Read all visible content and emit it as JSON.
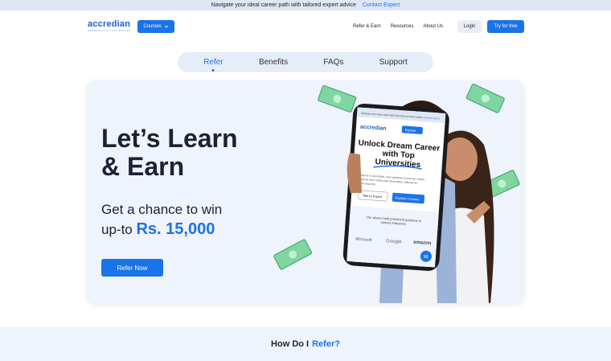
{
  "topbar": {
    "message": "Navigate your ideal career path with tailored expert advice",
    "link": "Contact Expert"
  },
  "nav": {
    "logo": "accredian",
    "logo_tag": "CREDENTIALS THAT MATTER",
    "courses": "Courses",
    "links": [
      "Refer & Earn",
      "Resources",
      "About Us"
    ],
    "login": "Login",
    "try": "Try for free"
  },
  "tabs": [
    "Refer",
    "Benefits",
    "FAQs",
    "Support"
  ],
  "hero": {
    "title_line1": "Let’s Learn",
    "title_line2": "& Earn",
    "sub_line1": "Get a chance to win",
    "sub_prefix": "up-to",
    "amount": "Rs. 15,000",
    "cta": "Refer Now"
  },
  "phone": {
    "top_text": "Navigate your ideal career path with tailored expert advice",
    "contact": "Contact Expert",
    "logo": "accredian",
    "explore": "Explore",
    "headline": "Unlock Dream Career with Top Universities",
    "body": "Welcome to Accredian, your gateway to premier online programs from Indian top universities, tailored for career success.",
    "btn1": "Talk to Expert",
    "btn2": "Explore Courses",
    "alumni": "Our alumni hold prominent positions in various industries.",
    "brand1": "Microsoft",
    "brand2": "Google",
    "brand3": "amazon"
  },
  "howdo": {
    "prefix": "How Do I",
    "highlight": "Refer?"
  },
  "colors": {
    "primary": "#1a73e8",
    "hero_bg": "#eef3fc",
    "tab_bg": "#e5edf8"
  }
}
